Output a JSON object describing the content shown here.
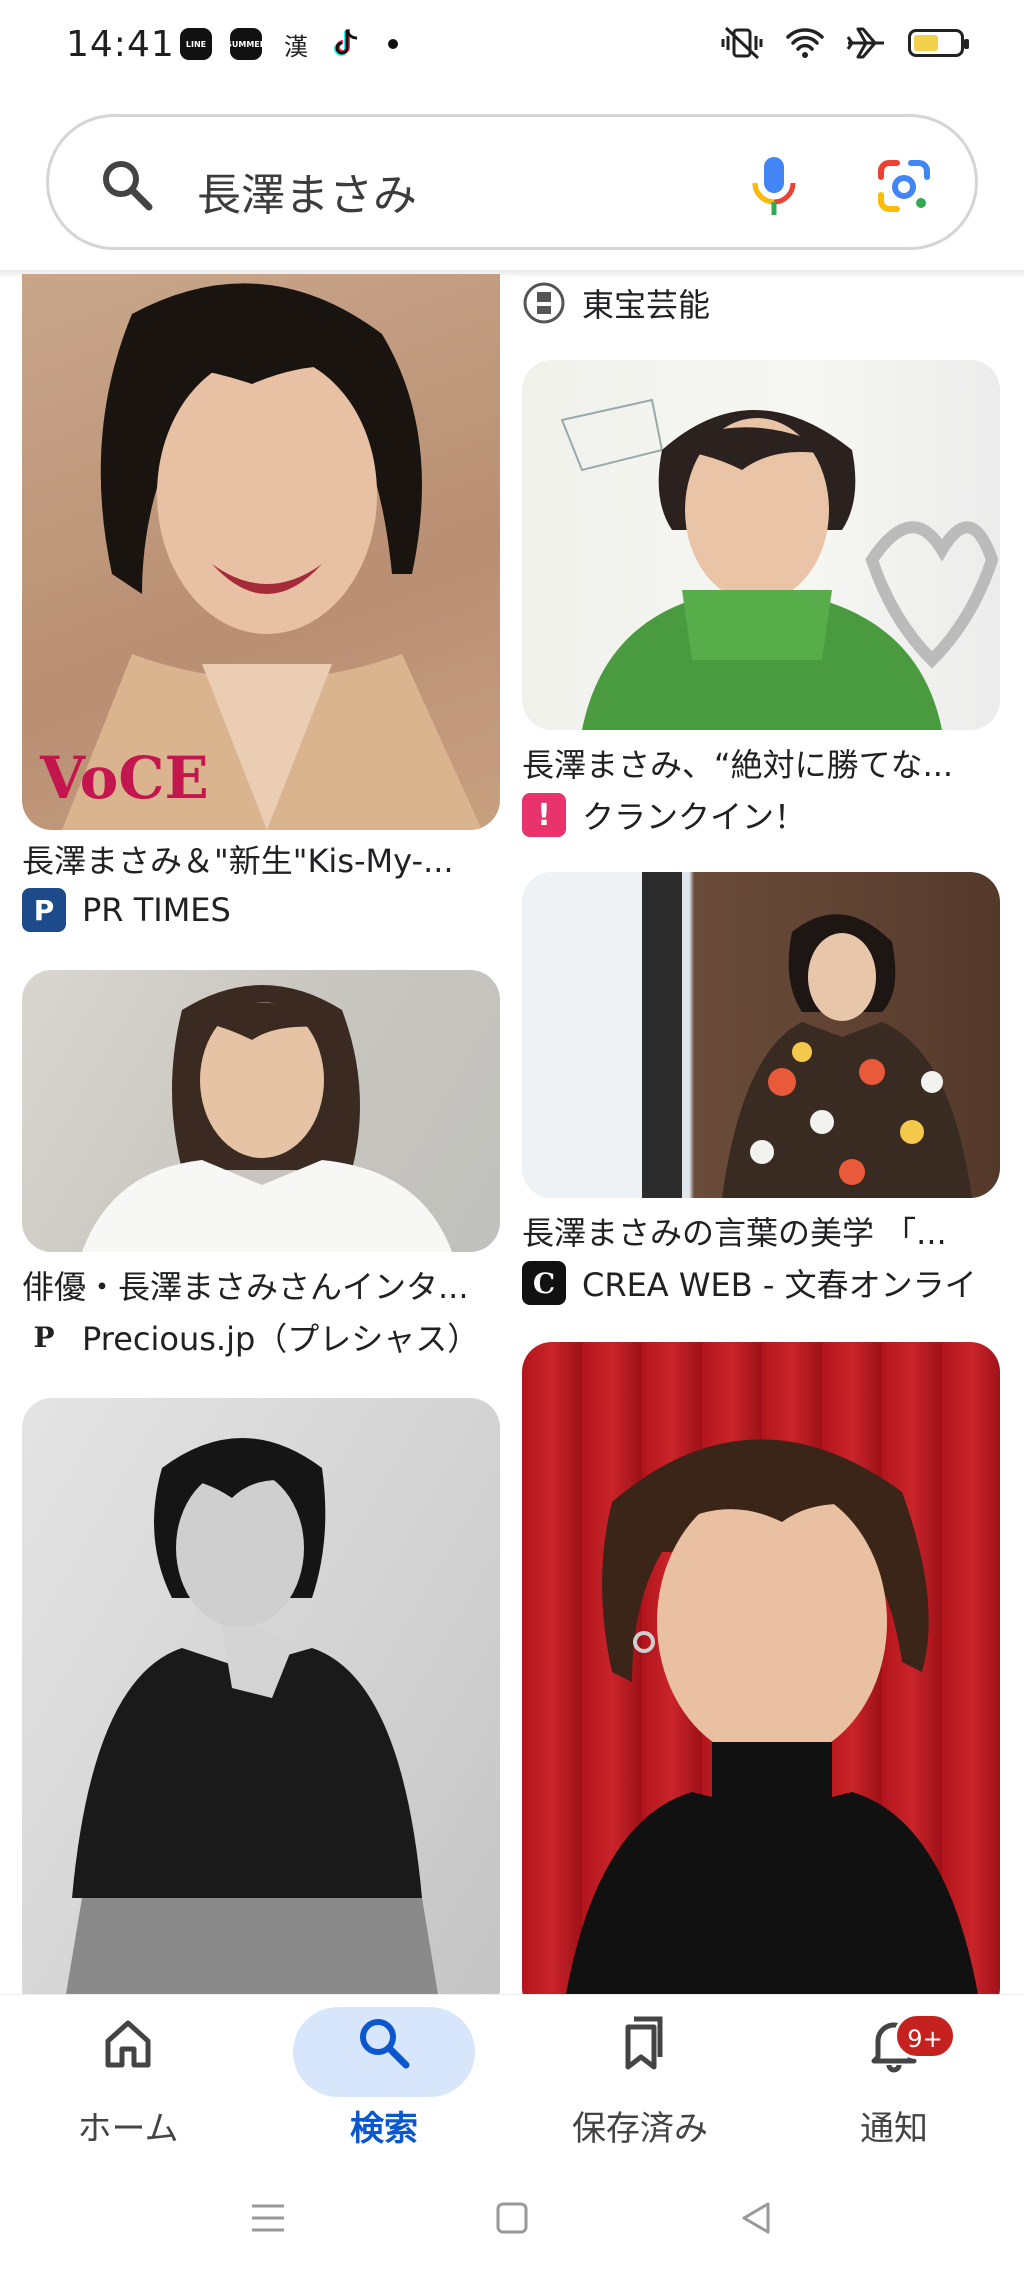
{
  "status_bar": {
    "time": "14:41",
    "app_icons": [
      "LINE",
      "SUMMER",
      "漢",
      "tiktok-icon"
    ],
    "right_icons": [
      "vibrate-icon",
      "wifi-icon",
      "airplane-icon",
      "battery-icon"
    ],
    "battery_level": 0.55
  },
  "search": {
    "query": "長澤まさみ",
    "icons": [
      "search-icon",
      "mic-icon",
      "google-lens-icon"
    ]
  },
  "results": [
    {
      "caption": "",
      "source": "東宝芸能",
      "source_icon": "toho-icon"
    },
    {
      "caption": "長澤まさみ＆\"新生\"Kis-My-...",
      "source": "PR TIMES",
      "source_icon": "P"
    },
    {
      "caption": "長澤まさみ、“絶対に勝てな...",
      "source": "クランクイン！",
      "source_icon": "!"
    },
    {
      "caption": "俳優・長澤まさみさんインタ...",
      "source": "Precious.jp（プレシャス）",
      "source_icon": "P"
    },
    {
      "caption": "長澤まさみの言葉の美学 「...",
      "source": "CREA WEB - 文春オンライ",
      "source_icon": "C"
    },
    {
      "caption": "",
      "source": "",
      "source_icon": ""
    },
    {
      "caption": "",
      "source": "",
      "source_icon": ""
    }
  ],
  "bottom_nav": {
    "items": [
      {
        "label": "ホーム",
        "icon": "home-icon"
      },
      {
        "label": "検索",
        "icon": "search-icon",
        "active": true
      },
      {
        "label": "保存済み",
        "icon": "bookmarks-icon"
      },
      {
        "label": "通知",
        "icon": "bell-icon",
        "badge": "9+"
      }
    ]
  },
  "system_nav": [
    "menu-icon",
    "home-square-icon",
    "back-icon"
  ],
  "colors": {
    "accent": "#0b57d0",
    "active_pill": "#d8e6fb",
    "badge": "#c5221f"
  }
}
